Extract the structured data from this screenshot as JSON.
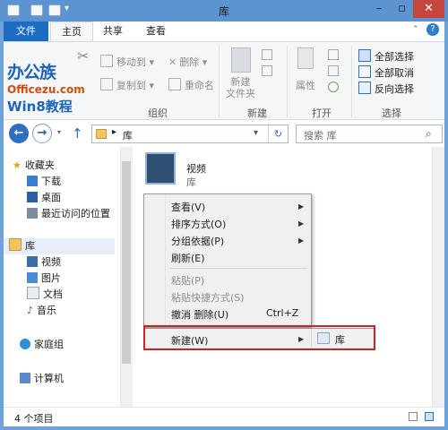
{
  "window": {
    "title": "库"
  },
  "tabs": {
    "file": "文件",
    "home": "主页",
    "share": "共享",
    "view": "查看"
  },
  "ribbon": {
    "move_to": "移动到",
    "copy_to": "复制到",
    "delete": "删除",
    "rename": "重命名",
    "new_folder": "新建\n文件夹",
    "properties": "属性",
    "select_all": "全部选择",
    "select_none": "全部取消",
    "invert_selection": "反向选择",
    "groups": {
      "organize": "组织",
      "new": "新建",
      "open": "打开",
      "select": "选择"
    }
  },
  "watermark": {
    "line1": "办公族",
    "line2": "Officezu.com",
    "line3": "Win8教程"
  },
  "address": {
    "path": "库",
    "search_placeholder": "搜索 库"
  },
  "sidebar": {
    "favorites": "收藏夹",
    "items": [
      {
        "label": "下载"
      },
      {
        "label": "桌面"
      },
      {
        "label": "最近访问的位置"
      }
    ],
    "library": "库",
    "library_items": [
      {
        "label": "视频"
      },
      {
        "label": "图片"
      },
      {
        "label": "文档"
      },
      {
        "label": "音乐"
      }
    ],
    "homegroup": "家庭组",
    "computer": "计算机"
  },
  "main": {
    "item_name": "视频",
    "item_sub": "库"
  },
  "context_menu": {
    "view": "查看(V)",
    "sort": "排序方式(O)",
    "group": "分组依据(P)",
    "refresh": "刷新(E)",
    "paste": "粘贴(P)",
    "paste_shortcut": "粘贴快捷方式(S)",
    "undo": "撤消 删除(U)",
    "undo_shortcut": "Ctrl+Z",
    "new": "新建(W)",
    "submenu_library": "库"
  },
  "status": {
    "count": "4 个项目"
  },
  "colors": {
    "accent": "#1c6cc4",
    "highlight_border": "#d31f26",
    "frame": "#6fa3d8"
  }
}
